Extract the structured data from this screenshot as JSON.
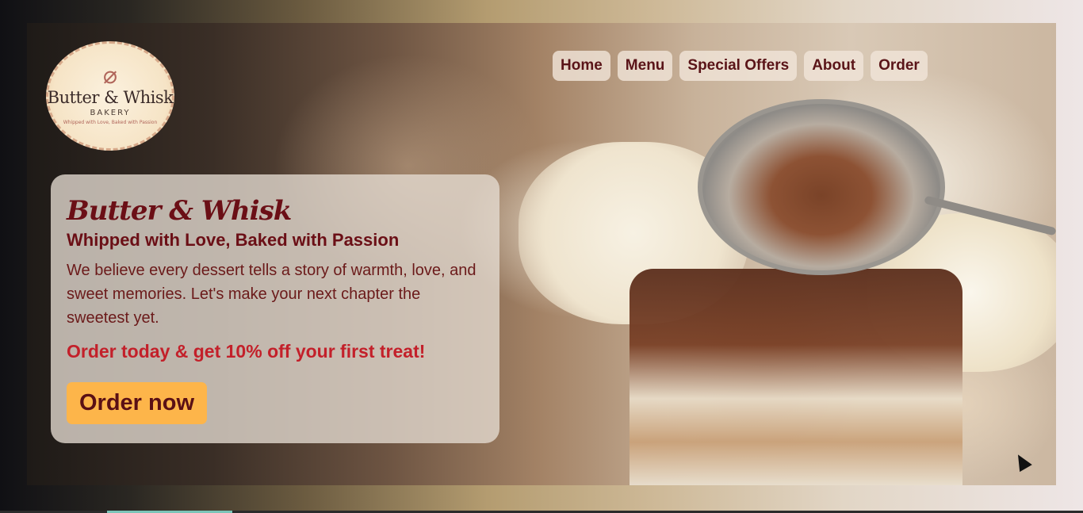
{
  "logo": {
    "name": "Butter & Whisk",
    "subtitle": "BAKERY",
    "tagline": "Whipped with Love, Baked with Passion",
    "icon": "whisk-butter-icon"
  },
  "nav": {
    "items": [
      {
        "label": "Home"
      },
      {
        "label": "Menu"
      },
      {
        "label": "Special Offers"
      },
      {
        "label": "About"
      },
      {
        "label": "Order"
      }
    ]
  },
  "hero": {
    "title": "Butter & Whisk",
    "tagline": "Whipped with Love, Baked with Passion",
    "description": "We believe every dessert tells a story of warmth, love, and sweet memories. Let's make your next chapter the sweetest yet.",
    "promo": "Order today & get 10% off your first treat!",
    "cta_label": "Order now"
  },
  "colors": {
    "accent": "#6b0f16",
    "promo": "#c3202a",
    "cta_bg": "#fdb54a"
  }
}
